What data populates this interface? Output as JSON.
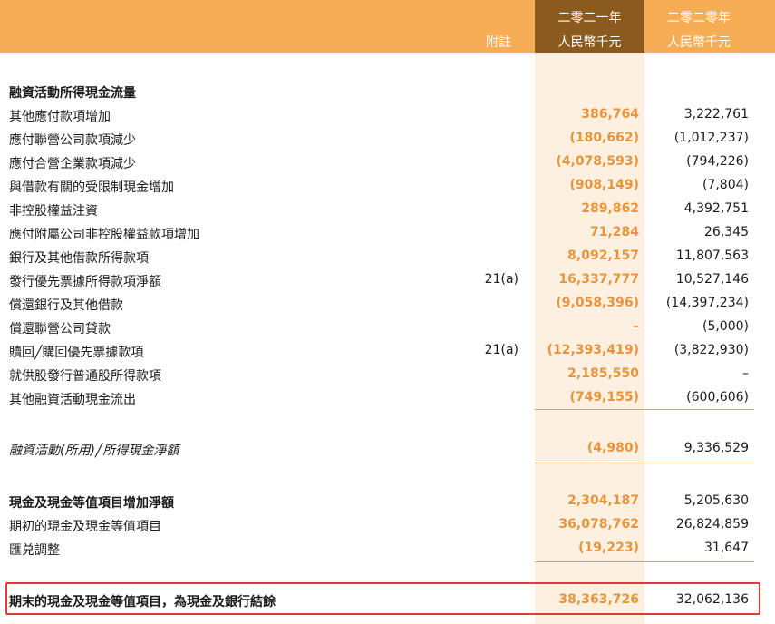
{
  "header": {
    "note_label": "附註",
    "current_year": "二零二一年",
    "current_unit": "人民幣千元",
    "prior_year": "二零二零年",
    "prior_unit": "人民幣千元"
  },
  "section_title": "融資活動所得現金流量",
  "rows": [
    {
      "label": "其他應付款項增加",
      "note": "",
      "current": "386,764",
      "prior": "3,222,761"
    },
    {
      "label": "應付聯營公司款項減少",
      "note": "",
      "current": "(180,662)",
      "prior": "(1,012,237)"
    },
    {
      "label": "應付合營企業款項減少",
      "note": "",
      "current": "(4,078,593)",
      "prior": "(794,226)"
    },
    {
      "label": "與借款有關的受限制現金增加",
      "note": "",
      "current": "(908,149)",
      "prior": "(7,804)"
    },
    {
      "label": "非控股權益注資",
      "note": "",
      "current": "289,862",
      "prior": "4,392,751"
    },
    {
      "label": "應付附屬公司非控股權益款項增加",
      "note": "",
      "current": "71,284",
      "prior": "26,345"
    },
    {
      "label": "銀行及其他借款所得款項",
      "note": "",
      "current": "8,092,157",
      "prior": "11,807,563"
    },
    {
      "label": "發行優先票據所得款項淨額",
      "note": "21(a)",
      "current": "16,337,777",
      "prior": "10,527,146"
    },
    {
      "label": "償還銀行及其他借款",
      "note": "",
      "current": "(9,058,396)",
      "prior": "(14,397,234)"
    },
    {
      "label": "償還聯營公司貸款",
      "note": "",
      "current": "–",
      "prior": "(5,000)"
    },
    {
      "label": "贖回╱購回優先票據款項",
      "note": "21(a)",
      "current": "(12,393,419)",
      "prior": "(3,822,930)"
    },
    {
      "label": "就供股發行普通股所得款項",
      "note": "",
      "current": "2,185,550",
      "prior": "–"
    },
    {
      "label": "其他融資活動現金流出",
      "note": "",
      "current": "(749,155)",
      "prior": "(600,606)"
    }
  ],
  "net_financing": {
    "label": "融資活動(所用)╱所得現金淨額",
    "current": "(4,980)",
    "prior": "9,336,529"
  },
  "summary": [
    {
      "label": "現金及現金等值項目增加淨額",
      "current": "2,304,187",
      "prior": "5,205,630"
    },
    {
      "label": "期初的現金及現金等值項目",
      "current": "36,078,762",
      "prior": "26,824,859"
    },
    {
      "label": "匯兑調整",
      "current": "(19,223)",
      "prior": "31,647"
    }
  ],
  "final": {
    "label": "期末的現金及現金等值項目，為現金及銀行結餘",
    "current": "38,363,726",
    "prior": "32,062,136"
  },
  "colors": {
    "header": "#f6ad55",
    "current_header": "#8b5a1f",
    "current_column": "#fdf0e1",
    "current_text": "#e8943a",
    "highlight": "#e53935"
  }
}
